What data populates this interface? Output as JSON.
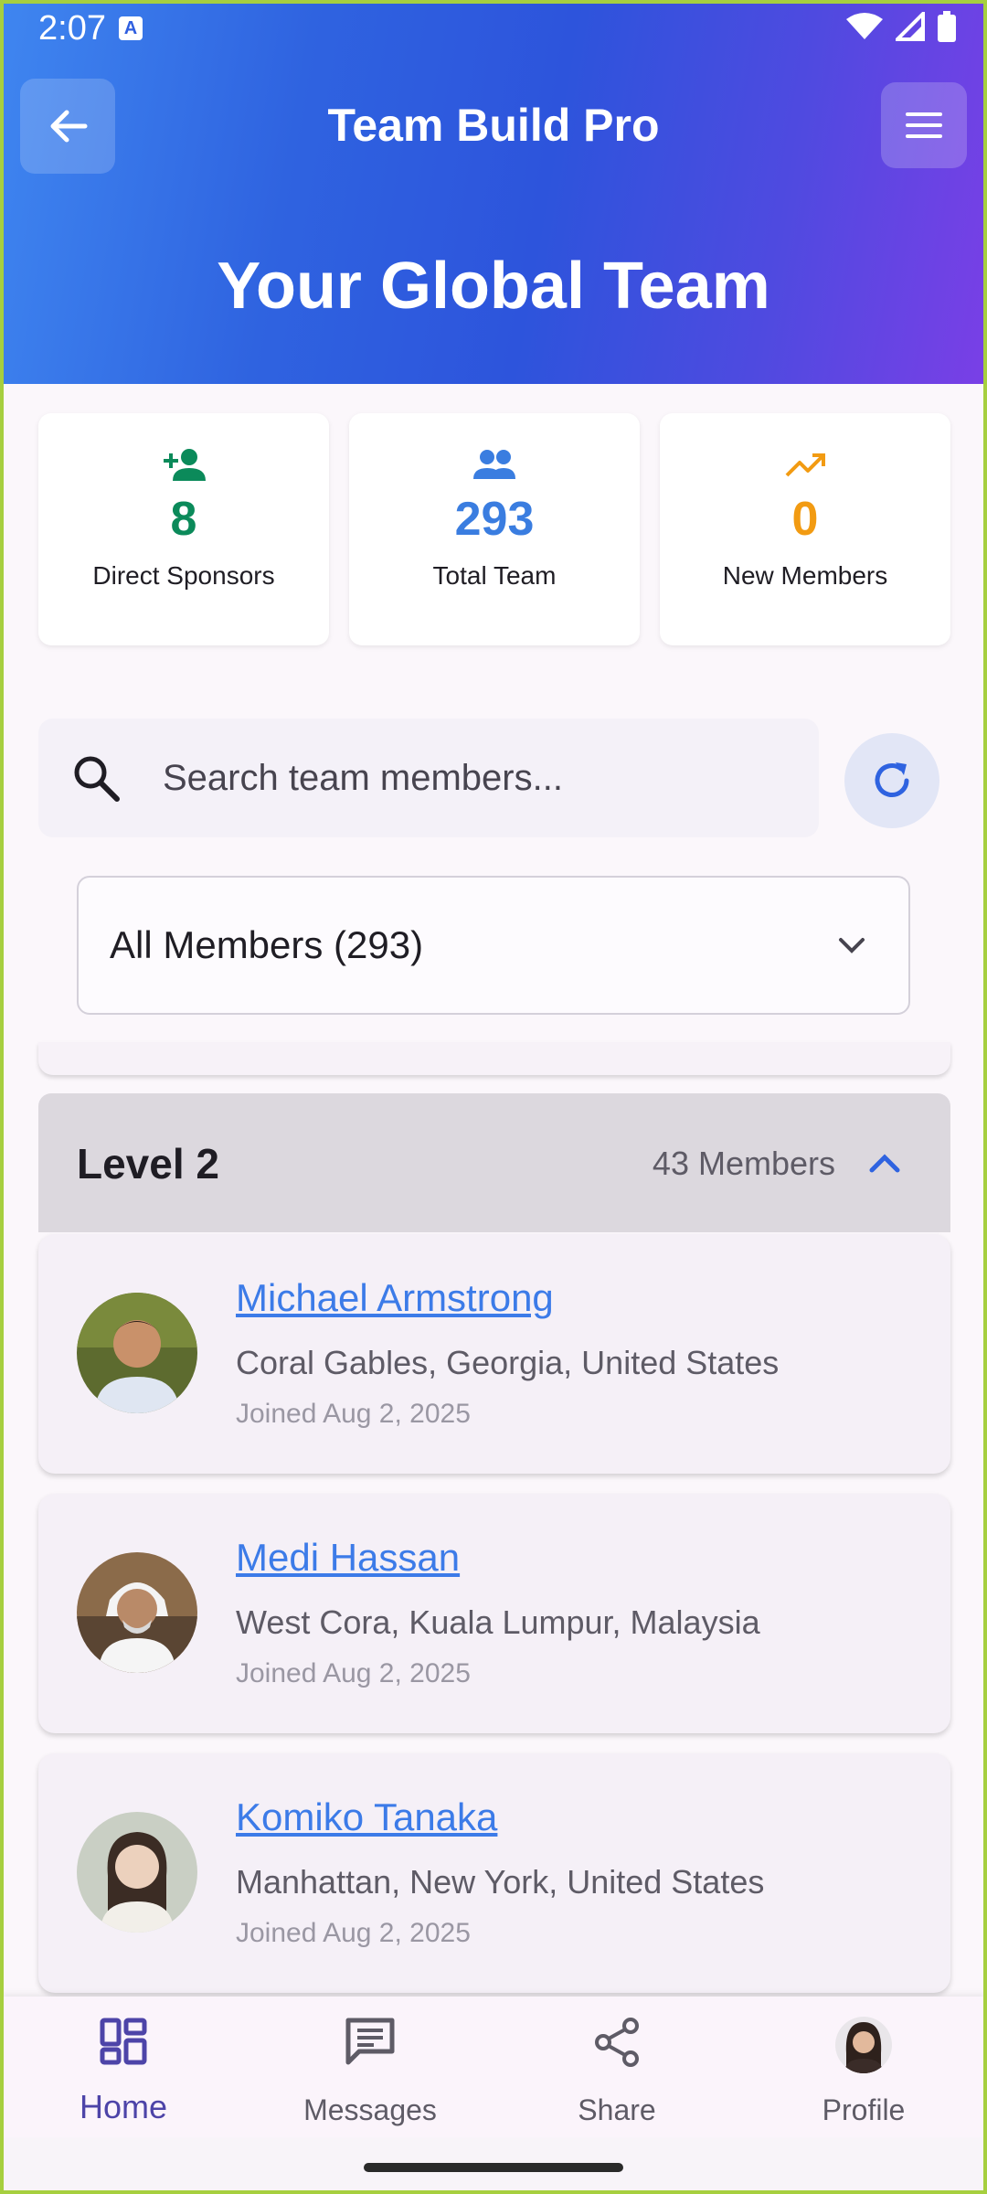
{
  "status": {
    "time": "2:07",
    "a_badge": "A"
  },
  "header": {
    "app_title": "Team Build Pro",
    "page_title": "Your Global Team"
  },
  "stats": [
    {
      "value": "8",
      "label": "Direct Sponsors",
      "icon": "person-add-icon",
      "color": "#0b8a5a"
    },
    {
      "value": "293",
      "label": "Total Team",
      "icon": "group-icon",
      "color": "#3a7de0"
    },
    {
      "value": "0",
      "label": "New Members",
      "icon": "trending-up-icon",
      "color": "#f29b12"
    }
  ],
  "search": {
    "placeholder": "Search team members..."
  },
  "filter": {
    "selected": "All Members (293)"
  },
  "level": {
    "title": "Level 2",
    "count": "43 Members"
  },
  "members": [
    {
      "name": "Michael Armstrong",
      "location": "Coral Gables, Georgia, United States",
      "joined": "Joined Aug 2, 2025"
    },
    {
      "name": "Medi Hassan",
      "location": "West Cora, Kuala Lumpur, Malaysia",
      "joined": "Joined Aug 2, 2025"
    },
    {
      "name": "Komiko Tanaka",
      "location": "Manhattan, New York, United States",
      "joined": "Joined Aug 2, 2025"
    }
  ],
  "nav": [
    {
      "label": "Home",
      "icon": "dashboard-icon"
    },
    {
      "label": "Messages",
      "icon": "message-icon"
    },
    {
      "label": "Share",
      "icon": "share-icon"
    },
    {
      "label": "Profile",
      "icon": "profile-avatar"
    }
  ],
  "colors": {
    "accent": "#3c7be8",
    "nav_active": "#4d44a8"
  }
}
